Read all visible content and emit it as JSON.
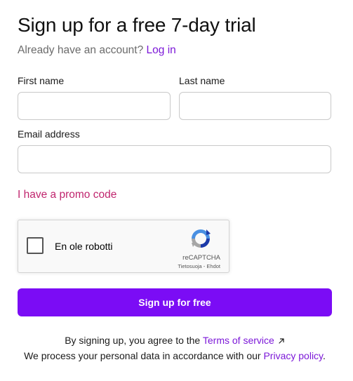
{
  "header": {
    "title": "Sign up for a free 7-day trial",
    "already_text": "Already have an account?",
    "login_link": "Log in"
  },
  "form": {
    "first_name": {
      "label": "First name",
      "value": "",
      "placeholder": ""
    },
    "last_name": {
      "label": "Last name",
      "value": "",
      "placeholder": ""
    },
    "email": {
      "label": "Email address",
      "value": "",
      "placeholder": ""
    },
    "promo_link": "I have a promo code",
    "submit_label": "Sign up for free"
  },
  "captcha": {
    "label": "En ole robotti",
    "brand": "reCAPTCHA",
    "privacy_link": "Tietosuoja",
    "separator": "-",
    "terms_link": "Ehdot",
    "icon": "recaptcha-logo-icon"
  },
  "legal": {
    "line1_prefix": "By signing up, you agree to the",
    "terms_link": "Terms of service",
    "terms_icon": "external-link-icon",
    "line2_prefix": "We process your personal data in accordance with our",
    "privacy_link": "Privacy policy",
    "line2_suffix": "."
  },
  "colors": {
    "accent": "#7b0cf5",
    "link": "#7c18d8",
    "promo": "#c0256e",
    "muted_text": "#6b6b6b",
    "input_border": "#c9c9c9"
  }
}
